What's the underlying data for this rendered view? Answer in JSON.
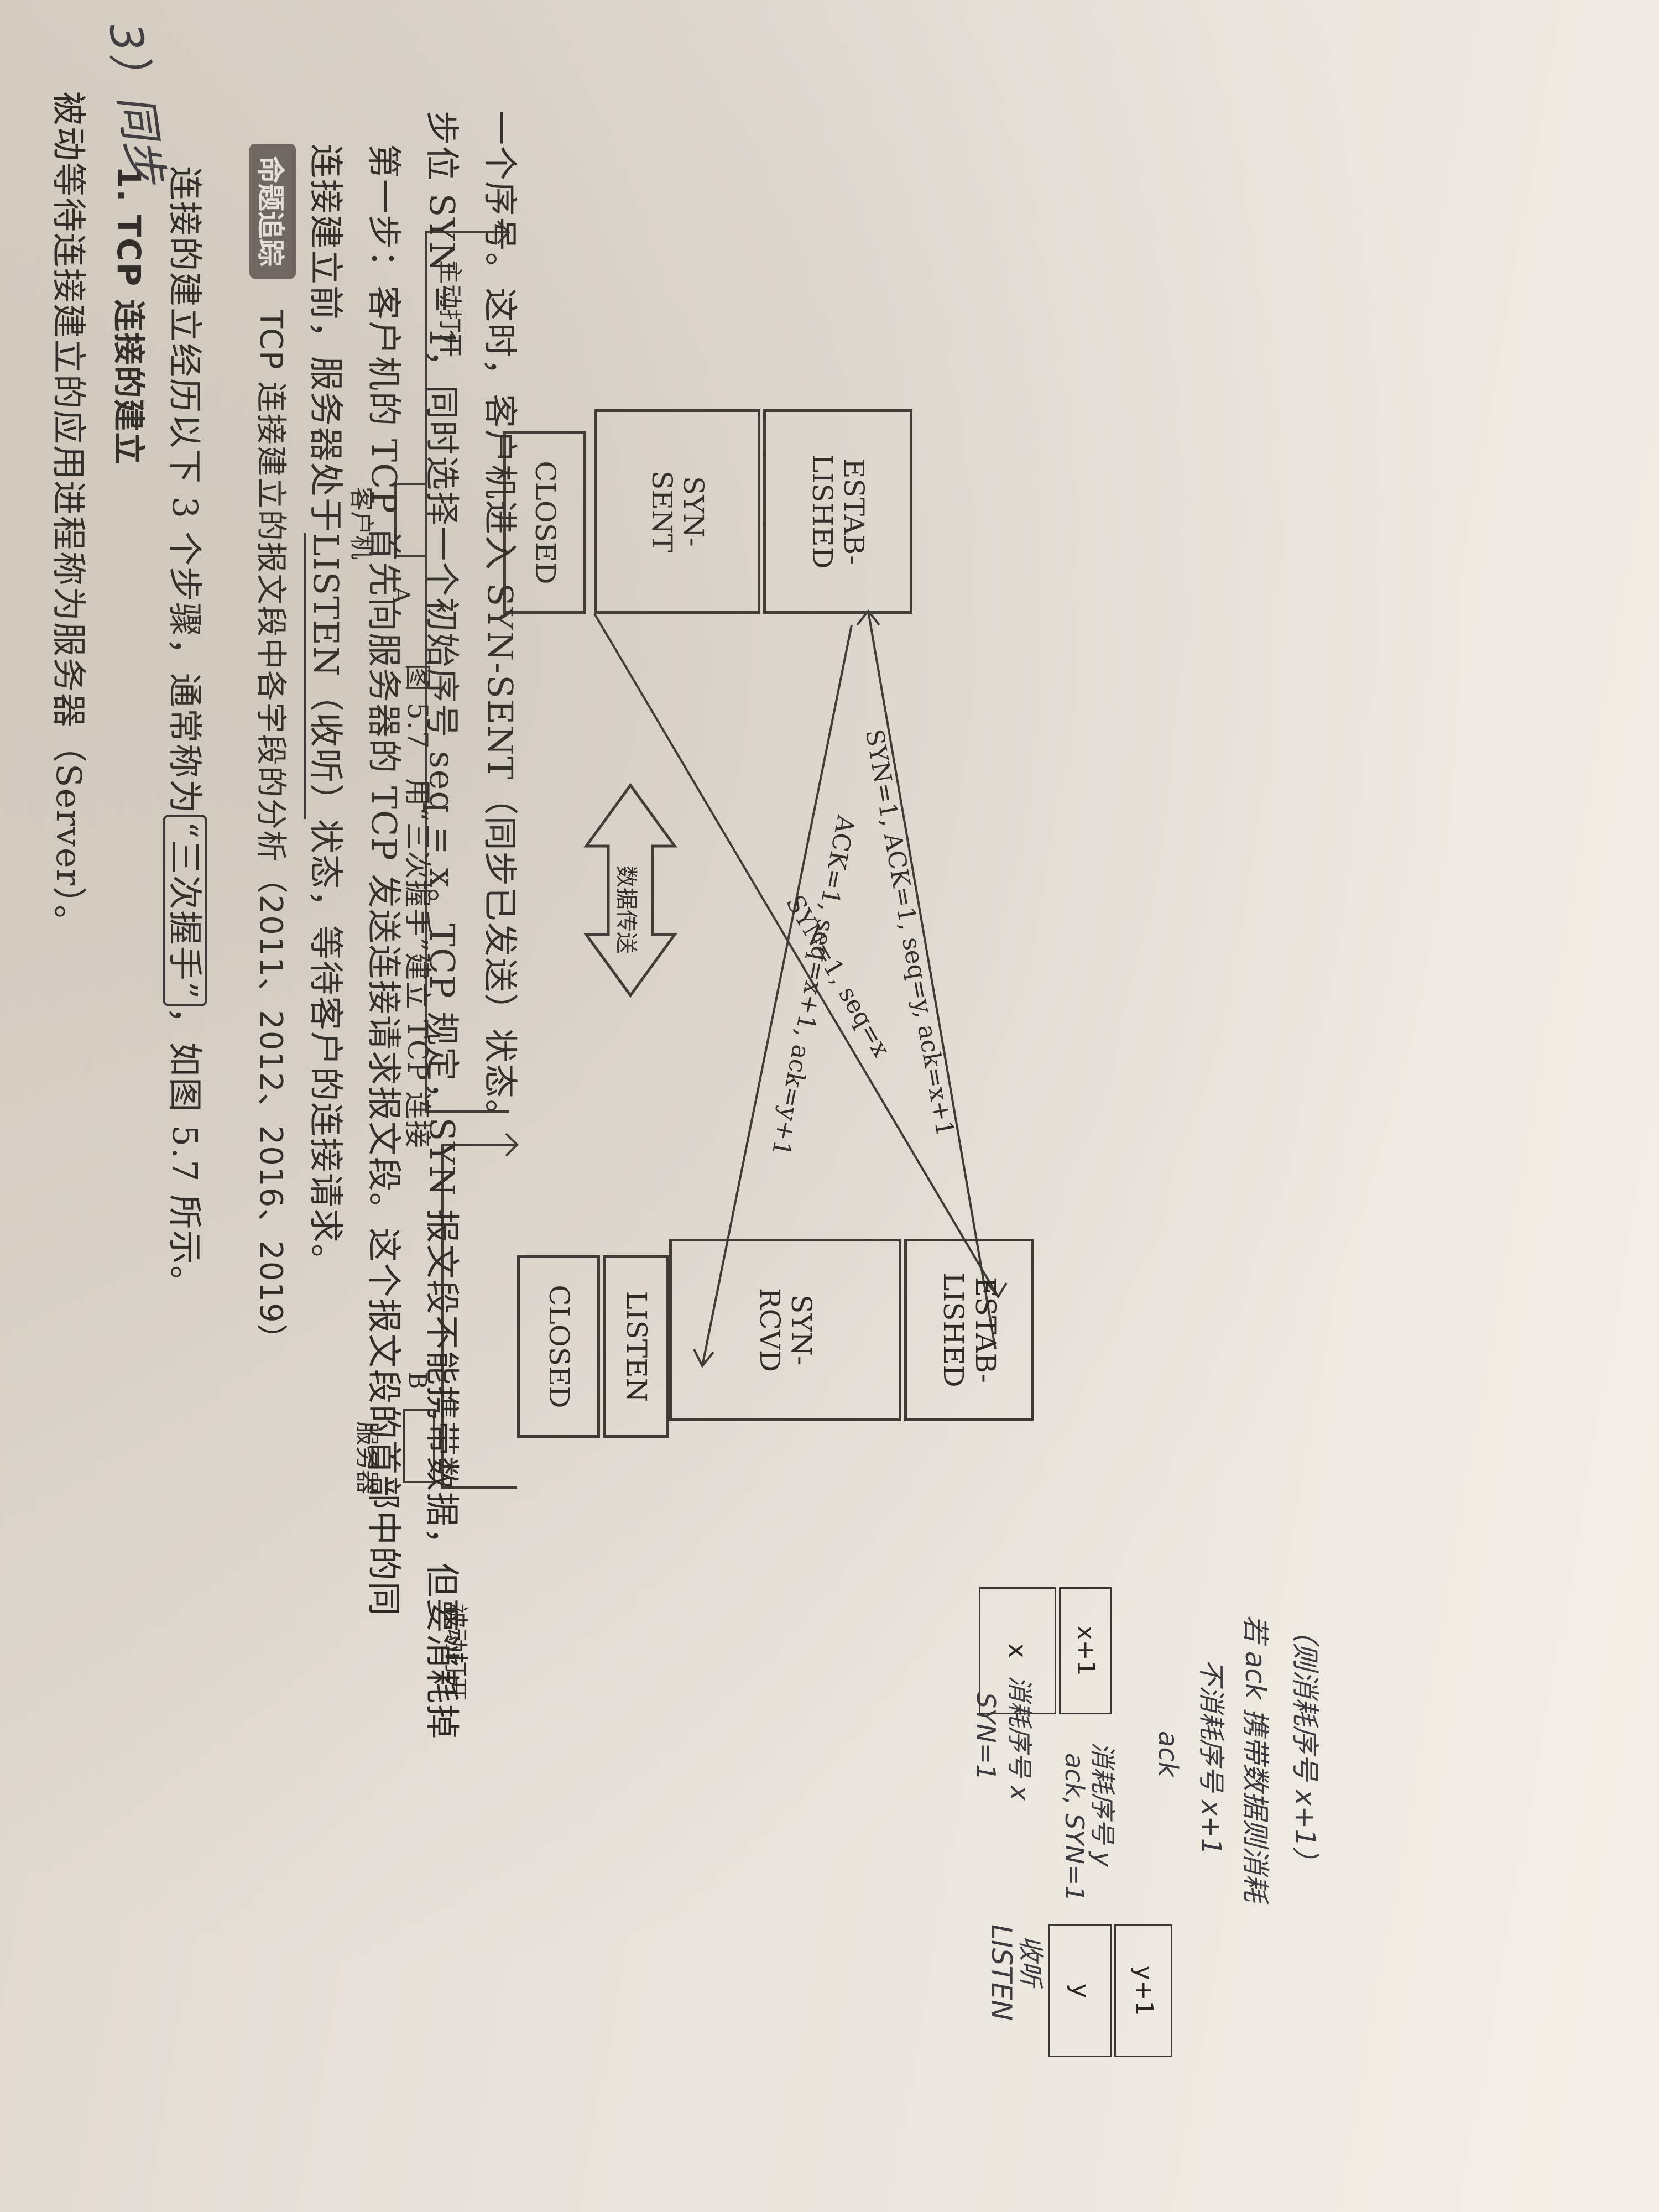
{
  "text": {
    "line1": "被动等待连接建立的应用进程称为服务器（Server）。",
    "section_heading": "1. TCP 连接的建立",
    "line2_a": "连接的建立经历以下 3 个步骤，通常称为",
    "line2_b": "“三次握手”",
    "line2_c": "，如图 5.7 所示。",
    "tag_label": "命题追踪",
    "trace_line": "TCP 连接建立的报文段中各字段的分析（2011、2012、2016、2019）",
    "body1_a": "连接建立前，服务器处于",
    "body1_b": "LISTEN（收听）",
    "body1_c": "状态，等待客户的连接请求。",
    "step1_a": "第一步：客户机的 TCP 首先向服务器的 TCP 发送连接请求报文段。这个报文段的首部中的同",
    "step1_b": "步位 SYN = 1，同时选择一个初始序号 seq = x。TCP 规定，SYN 报文段不能携带数据，但要消耗掉",
    "step1_c": "一个序号。这时，客户机进入 SYN-SENT（同步已发送）状态。"
  },
  "figure": {
    "client_label": "客户机",
    "client_letter": "A",
    "server_label": "服务器",
    "server_letter": "B",
    "active_open": "主动打开",
    "passive_open": "被动打开",
    "client_states": [
      "CLOSED",
      "SYN-\nSENT",
      "ESTAB-\nLISHED"
    ],
    "server_states": [
      "CLOSED",
      "LISTEN",
      "SYN-\nRCVD",
      "ESTAB-\nLISHED"
    ],
    "msg1": "SYN=1, seq=x",
    "msg2": "SYN=1, ACK=1, seq=y, ack=x+1",
    "msg3": "ACK=1, seq=x+1, ack=y+1",
    "data_transfer": "数据传送",
    "caption": "图 5.7　用“三次握手”建立 TCP 连接"
  },
  "handwriting": {
    "corner": "3）同步",
    "syn1": "SYN=1",
    "consume_x": "消耗序号 x",
    "listen": "LISTEN",
    "listen_state": "收听",
    "box_x": "x",
    "box_x1": "x+1",
    "ack_syn": "ack, SYN=1",
    "consume_y": "消耗序号 y",
    "box_y": "y",
    "box_y1": "y+1",
    "ack": "ack",
    "no_consume": "不消耗序号 x+1",
    "note1": "若 ack 携带数据则消耗",
    "note2": "（则消耗序号 x+1）"
  }
}
